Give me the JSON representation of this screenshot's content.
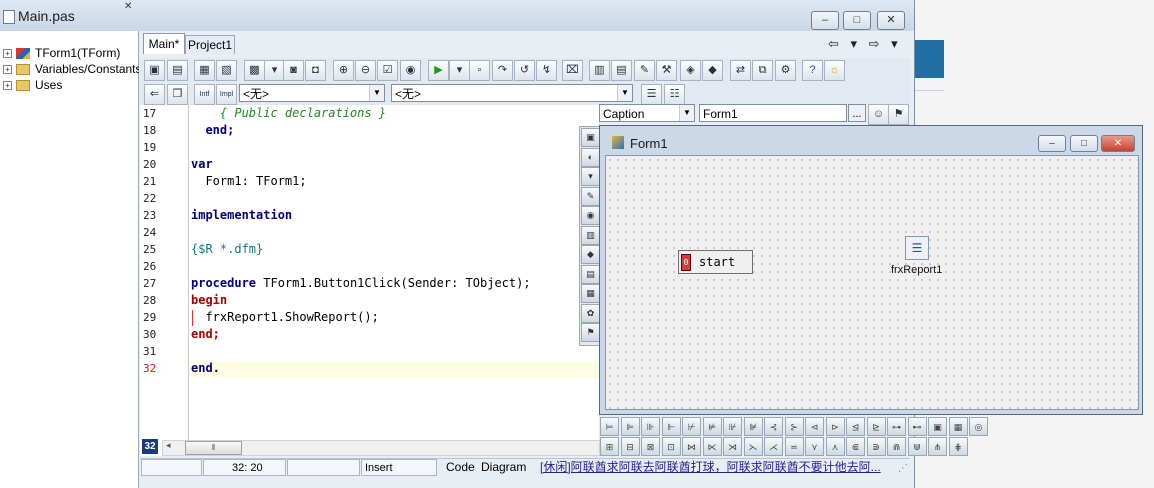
{
  "window": {
    "title": "Main.pas",
    "buttons": [
      "–",
      "□",
      "✕"
    ]
  },
  "tree": {
    "items": [
      {
        "label": "TForm1(TForm)",
        "icon": "form-icon"
      },
      {
        "label": "Variables/Constants",
        "icon": "folder-icon"
      },
      {
        "label": "Uses",
        "icon": "folder-icon"
      }
    ]
  },
  "tabs": [
    {
      "label": "Main*"
    },
    {
      "label": "Project1"
    }
  ],
  "toolbar2": {
    "intf": "Intf",
    "impl": "Impl",
    "combo1": "<无>",
    "combo2": "<无>"
  },
  "code": {
    "lines": [
      {
        "n": "17",
        "text": "    { Public declarations }",
        "cls": "cm"
      },
      {
        "n": "18",
        "text": "  end;",
        "cls": "kw"
      },
      {
        "n": "19",
        "text": "",
        "cls": ""
      },
      {
        "n": "20",
        "text": "var",
        "cls": "kw"
      },
      {
        "n": "21",
        "text": "  Form1: TForm1;",
        "cls": ""
      },
      {
        "n": "22",
        "text": "",
        "cls": ""
      },
      {
        "n": "23",
        "text": "implementation",
        "cls": "kw"
      },
      {
        "n": "24",
        "text": "",
        "cls": ""
      },
      {
        "n": "25",
        "text": "{$R *.dfm}",
        "cls": "dir"
      },
      {
        "n": "26",
        "text": "",
        "cls": ""
      },
      {
        "n": "27",
        "text": "procedure TForm1.Button1Click(Sender: TObject);",
        "cls": "proc"
      },
      {
        "n": "28",
        "text": "begin",
        "cls": "bp"
      },
      {
        "n": "29",
        "text": "  frxReport1.ShowReport();",
        "cls": ""
      },
      {
        "n": "30",
        "text": "end;",
        "cls": "bp"
      },
      {
        "n": "31",
        "text": "",
        "cls": ""
      },
      {
        "n": "32",
        "text": "end.",
        "cls": "kw"
      }
    ],
    "current_line": "32"
  },
  "inspector": {
    "property": "Caption",
    "value": "Form1",
    "ellipsis": "..."
  },
  "status": {
    "position": "32: 20",
    "mode": "Insert",
    "tab_code": "Code",
    "tab_diagram": "Diagram",
    "message": "[休闲]阿联酋求阿联去阿联酋打球，阿联求阿联酋不要计他去阿..."
  },
  "line_badge": "32",
  "form": {
    "title": "Form1",
    "button_label": "start",
    "component_label": "frxReport1"
  }
}
